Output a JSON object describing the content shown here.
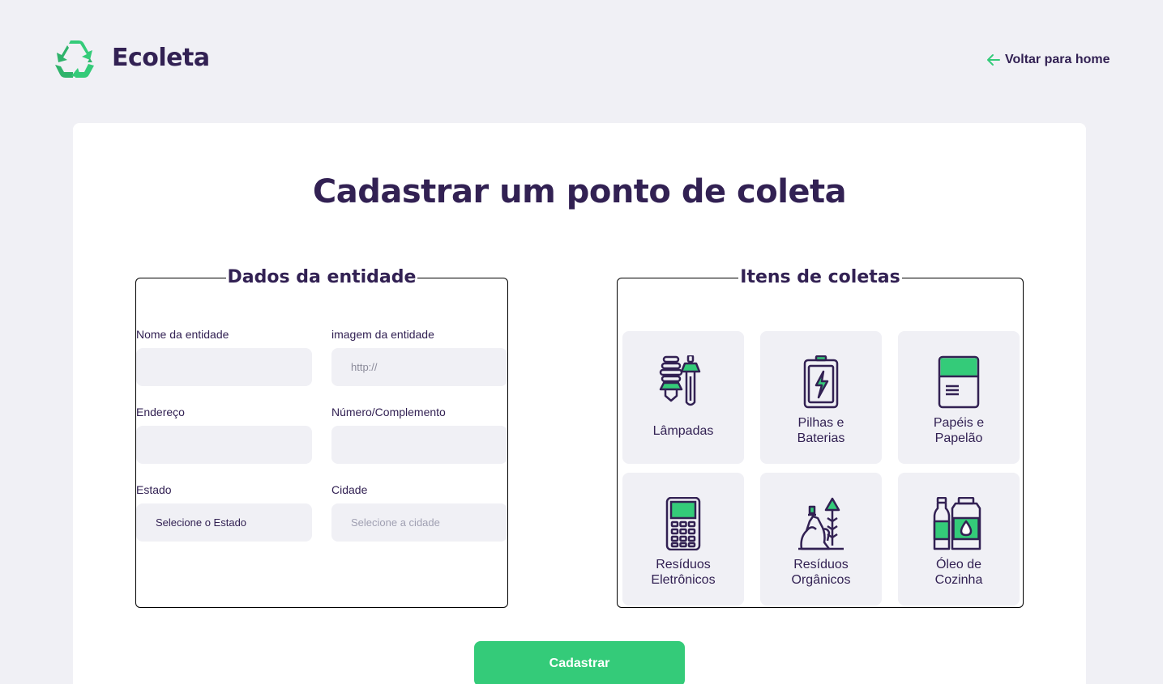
{
  "header": {
    "app_name": "Ecoleta",
    "back_label": "Voltar para home"
  },
  "page": {
    "title": "Cadastrar um ponto de coleta",
    "submit_label": "Cadastrar"
  },
  "dados": {
    "legend": "Dados da entidade",
    "fields": {
      "nome": {
        "label": "Nome da entidade",
        "value": ""
      },
      "imagem": {
        "label": "imagem da entidade",
        "placeholder": "http://"
      },
      "endereco": {
        "label": "Endereço",
        "value": ""
      },
      "numero": {
        "label": "Número/Complemento",
        "value": ""
      },
      "estado": {
        "label": "Estado",
        "selected": "Selecione o Estado"
      },
      "cidade": {
        "label": "Cidade",
        "selected": "Selecione a cidade"
      }
    }
  },
  "itens": {
    "legend": "Itens de coletas",
    "list": [
      {
        "line1": "Lâmpadas",
        "line2": "",
        "icon": "lamp-icon"
      },
      {
        "line1": "Pilhas e",
        "line2": "Baterias",
        "icon": "battery-icon"
      },
      {
        "line1": "Papéis e",
        "line2": "Papelão",
        "icon": "paper-icon"
      },
      {
        "line1": "Resíduos",
        "line2": "Eletrônicos",
        "icon": "electronics-icon"
      },
      {
        "line1": "Resíduos",
        "line2": "Orgânicos",
        "icon": "organic-icon"
      },
      {
        "line1": "Óleo de",
        "line2": "Cozinha",
        "icon": "oil-icon"
      }
    ]
  },
  "colors": {
    "primary": "#34cb79",
    "title": "#322153",
    "background": "#f0f0f5"
  }
}
